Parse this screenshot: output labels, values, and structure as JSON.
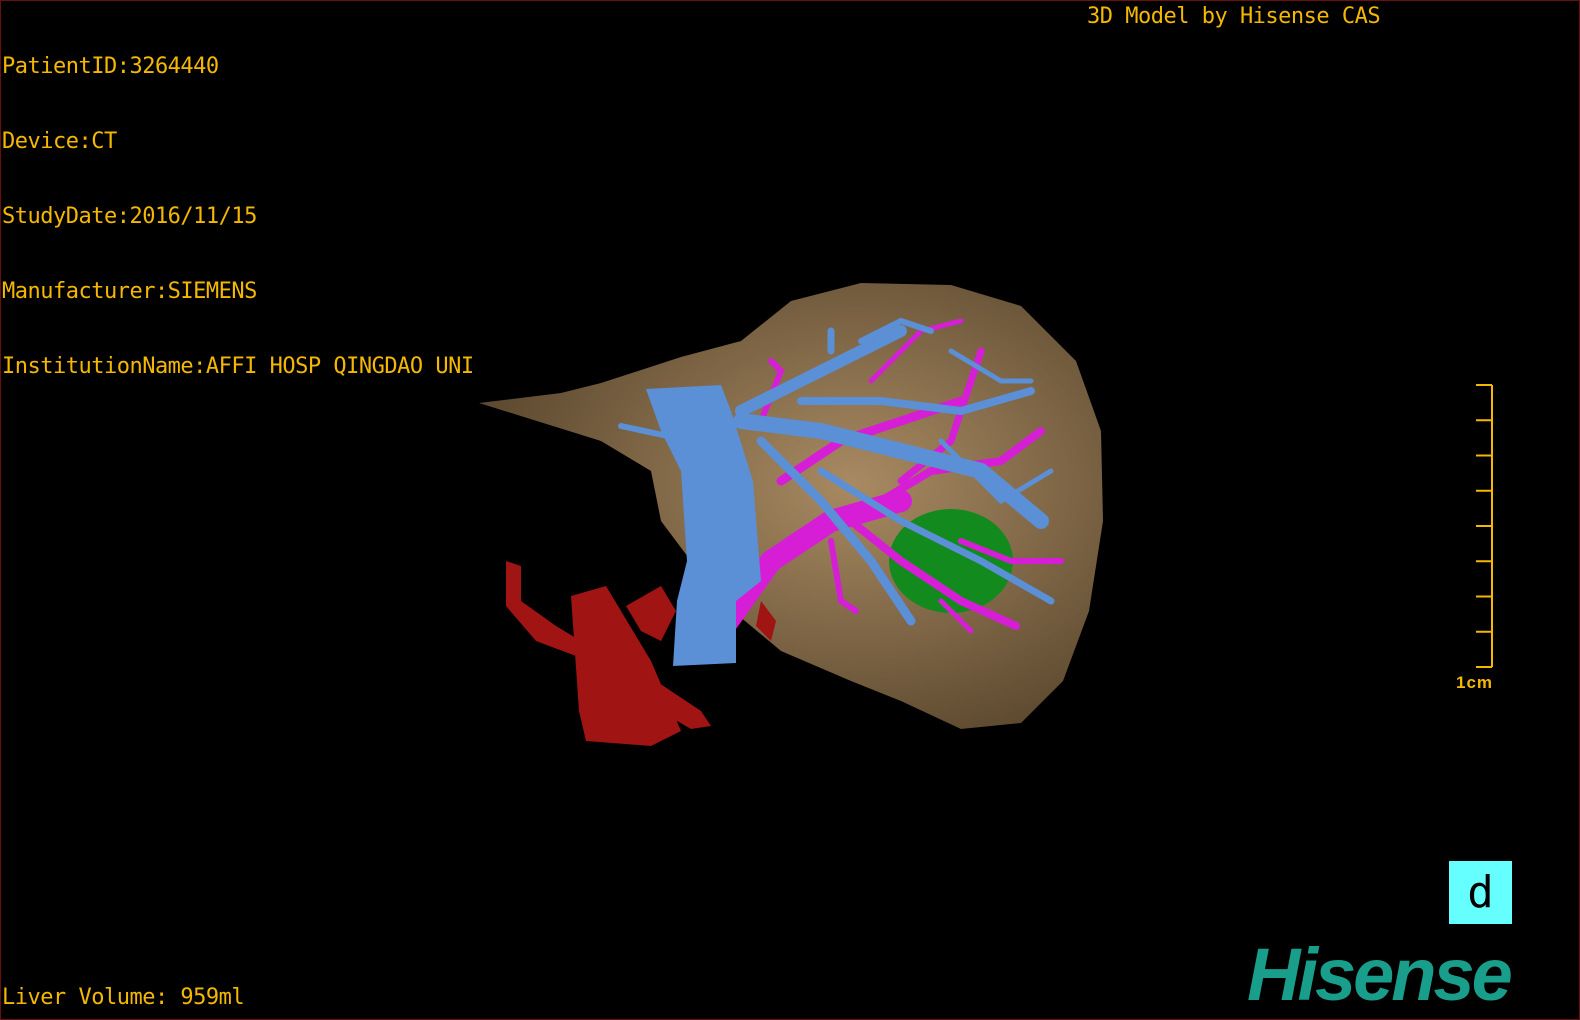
{
  "overlay": {
    "info_lines": [
      "PatientID:3264440",
      "Device:CT",
      "StudyDate:2016/11/15",
      "Manufacturer:SIEMENS",
      "InstitutionName:AFFI HOSP QINGDAO UNI"
    ],
    "brand_text": "3D Model by Hisense CAS",
    "liver_volume": "Liver Volume: 959ml"
  },
  "scale_bar": {
    "label": "1cm",
    "ticks": 9
  },
  "orientation_marker": {
    "letter": "d",
    "color": "#66ffff"
  },
  "logo": {
    "text": "Hisense",
    "color": "#1a9e8c"
  },
  "colors": {
    "overlay_text": "#f5b800",
    "liver": "#8a7150",
    "hepatic_vein": "#5b8fd6",
    "portal_vein": "#d61ed6",
    "artery": "#a01414",
    "lesion": "#138a1e"
  }
}
